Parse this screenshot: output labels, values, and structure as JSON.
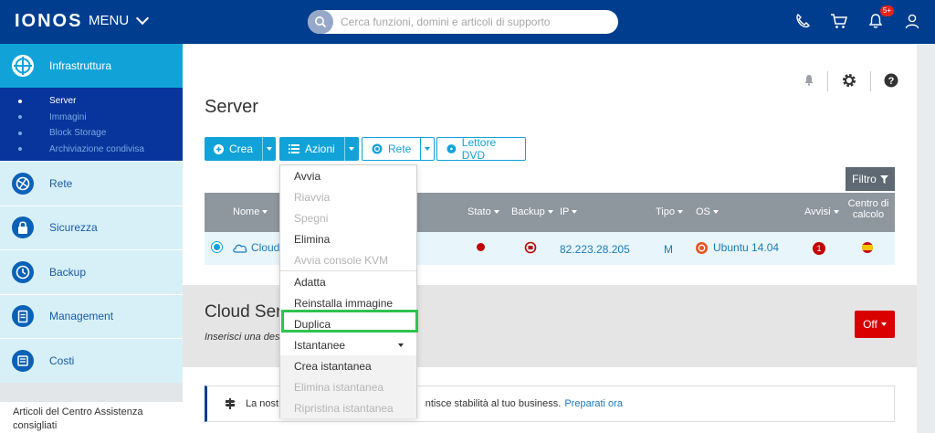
{
  "header": {
    "logo": "IONOS",
    "menu_label": "MENU",
    "search_placeholder": "Cerca funzioni, domini e articoli di supporto",
    "notifications_badge": "5+"
  },
  "sidebar": {
    "main": {
      "label": "Infrastruttura"
    },
    "sub_items": [
      {
        "label": "Server"
      },
      {
        "label": "Immagini"
      },
      {
        "label": "Block Storage"
      },
      {
        "label": "Archiviazione condivisa"
      }
    ],
    "items": [
      {
        "label": "Rete"
      },
      {
        "label": "Sicurezza"
      },
      {
        "label": "Backup"
      },
      {
        "label": "Management"
      },
      {
        "label": "Costi"
      }
    ],
    "bottom_text": "Articoli del Centro Assistenza consigliati"
  },
  "page": {
    "title": "Server"
  },
  "toolbar": {
    "crea_label": "Crea",
    "azioni_label": "Azioni",
    "rete_label": "Rete",
    "dvd_label": "Lettore DVD",
    "filtro_label": "Filtro"
  },
  "table": {
    "headers": {
      "nome": "Nome",
      "stato": "Stato",
      "backup": "Backup",
      "ip": "IP",
      "tipo": "Tipo",
      "os": "OS",
      "avvisi": "Avvisi",
      "centro": "Centro di calcolo"
    },
    "row": {
      "name": "Cloud S",
      "ip": "82.223.28.205",
      "tipo": "M",
      "os": "Ubuntu 14.04",
      "avvisi": "1"
    }
  },
  "cloud_section": {
    "title": "Cloud Ser",
    "subtitle": "Inserisci una des",
    "off_label": "Off"
  },
  "info": {
    "text_start": "La nostr",
    "text_end": "ntisce stabilità al tuo business.",
    "link": "Preparati ora"
  },
  "dropdown": {
    "items": [
      {
        "label": "Avvia",
        "disabled": false
      },
      {
        "label": "Riavvia",
        "disabled": true
      },
      {
        "label": "Spegni",
        "disabled": true
      },
      {
        "label": "Elimina",
        "disabled": false
      },
      {
        "label": "Avvia console KVM",
        "disabled": true
      }
    ],
    "items2": [
      {
        "label": "Adatta",
        "disabled": false
      },
      {
        "label": "Reinstalla immagine",
        "disabled": false
      },
      {
        "label": "Duplica",
        "disabled": false
      },
      {
        "label": "Istantanee",
        "disabled": false
      }
    ],
    "snapshots": [
      {
        "label": "Crea istantanea",
        "disabled": false
      },
      {
        "label": "Elimina istantanea",
        "disabled": true
      },
      {
        "label": "Ripristina istantanea",
        "disabled": true
      }
    ]
  },
  "colors": {
    "header_bg": "#003d8f",
    "accent": "#11a3d8",
    "highlight": "#2fc24f",
    "danger": "#d90000"
  }
}
